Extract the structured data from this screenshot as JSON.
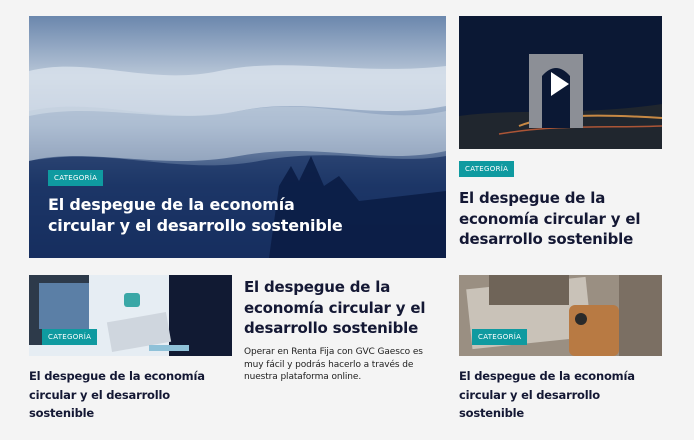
{
  "hero": {
    "category": "CATEGORÍA",
    "title": "El despegue de la economía circular y el desarrollo sostenible"
  },
  "top_right": {
    "category": "CATEGORÍA",
    "title": "El despegue de la economía circular y el desarrollo sostenible"
  },
  "bottom_left": {
    "category": "CATEGORÍA",
    "title": "El despegue de la economía circular y el desarrollo sostenible"
  },
  "bottom_middle": {
    "title": "El despegue de la economía circular y el desarrollo sostenible",
    "description": "Operar en Renta Fija con GVC Gaesco es muy fácil y podrás hacerlo a través de nuestra plataforma online."
  },
  "bottom_right": {
    "category": "CATEGORÍA",
    "title": "El despegue de la economía circular y el desarrollo sostenible"
  },
  "colors": {
    "accent": "#0f9aa0",
    "title": "#141834",
    "background": "#f4f4f4"
  },
  "icons": {
    "video": "play-icon"
  }
}
